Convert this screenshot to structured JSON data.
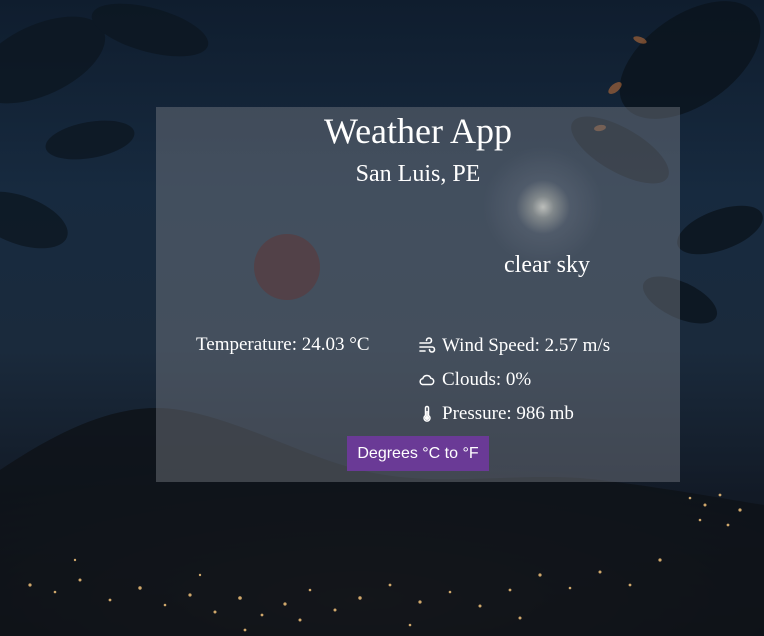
{
  "app": {
    "title": "Weather App",
    "location": "San Luis, PE",
    "description": "clear sky"
  },
  "stats": {
    "temperature": "Temperature: 24.03 °C",
    "wind": "Wind Speed: 2.57 m/s",
    "clouds": "Clouds: 0%",
    "pressure": "Pressure: 986 mb"
  },
  "icons": {
    "wind": "wind-icon",
    "clouds": "cloud-icon",
    "pressure": "thermometer-icon",
    "weather": "weather-condition-icon"
  },
  "controls": {
    "convert_label": "Degrees °C to °F"
  },
  "colors": {
    "button": "#6a3a96",
    "card": "rgba(120,125,132,0.45)"
  }
}
